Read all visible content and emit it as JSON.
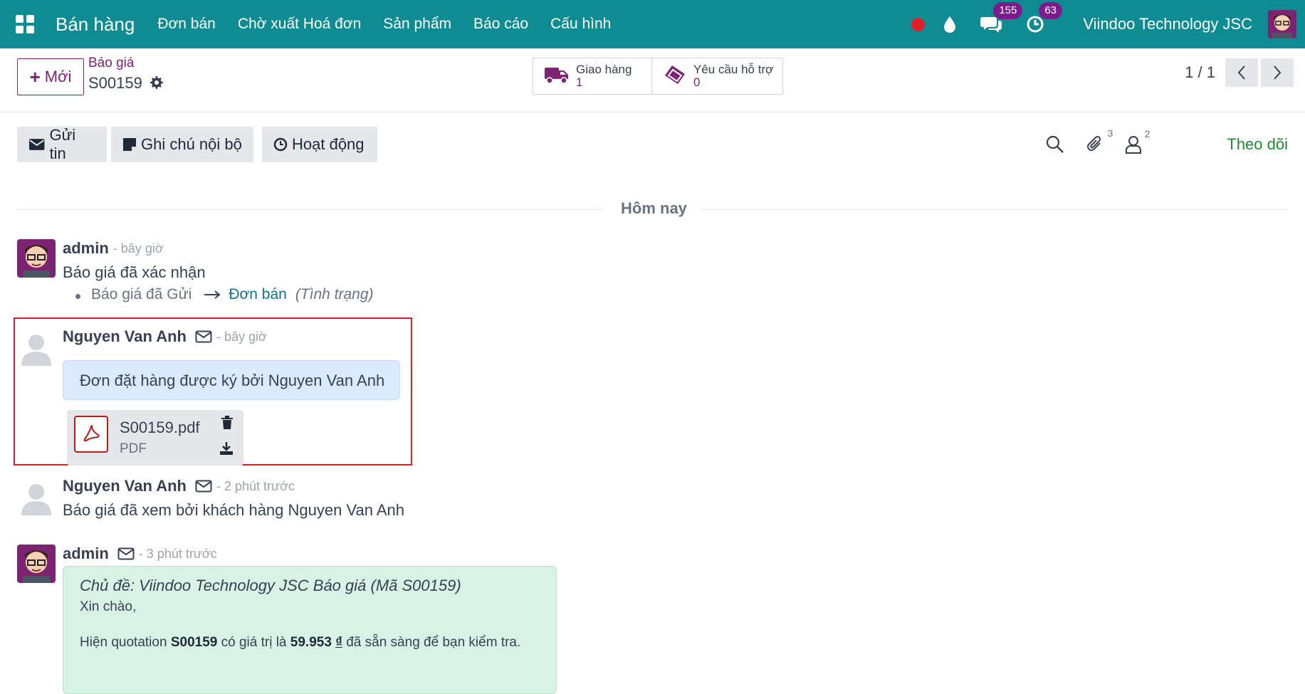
{
  "navbar": {
    "app_title": "Bán hàng",
    "menu": [
      "Đơn bán",
      "Chờ xuất Hoá đơn",
      "Sản phẩm",
      "Báo cáo",
      "Cấu hình"
    ],
    "messages_badge": "155",
    "activities_badge": "63",
    "company": "Viindoo Technology JSC"
  },
  "control": {
    "new_label": "Mới",
    "breadcrumb_parent": "Báo giá",
    "breadcrumb_current": "S00159",
    "smart_buttons": [
      {
        "label": "Giao hàng",
        "value": "1",
        "icon": "truck-icon"
      },
      {
        "label": "Yêu cầu hỗ trợ",
        "value": "0",
        "icon": "ticket-icon"
      }
    ],
    "pager": "1 / 1"
  },
  "chatter": {
    "send_message": "Gửi tin",
    "log_note": "Ghi chú nội bộ",
    "activity": "Hoạt động",
    "attachments_count": "3",
    "followers_count": "2",
    "follow_label": "Theo dõi",
    "day_separator": "Hôm nay"
  },
  "messages": [
    {
      "author": "admin",
      "time": "- bây giờ",
      "body": "Báo giá đã xác nhận",
      "tracking": {
        "old": "Báo giá đã Gửi",
        "new": "Đơn bán",
        "field": "(Tình trạng)"
      }
    },
    {
      "author": "Nguyen Van Anh",
      "time": "- bây giờ",
      "body": "Đơn đặt hàng được ký bởi Nguyen Van Anh",
      "attachment": {
        "name": "S00159.pdf",
        "type": "PDF"
      }
    },
    {
      "author": "Nguyen Van Anh",
      "time": "- 2 phút trước",
      "body": "Báo giá đã xem bởi khách hàng Nguyen Van Anh"
    },
    {
      "author": "admin",
      "time": "- 3 phút trước",
      "subject": "Chủ đề: Viindoo Technology JSC Báo giá (Mã S00159)",
      "greeting": "Xin chào,",
      "line_prefix": "Hiện quotation ",
      "line_ref": "S00159",
      "line_mid": " có giá trị là ",
      "line_amount": "59.953",
      "line_currency": "₫",
      "line_suffix": " đã sẵn sàng để bạn kiểm tra."
    }
  ],
  "colors": {
    "navbar": "#0e8c92",
    "primary": "#7c2372",
    "follow": "#1f8a30",
    "highlight": "#e11d24"
  }
}
